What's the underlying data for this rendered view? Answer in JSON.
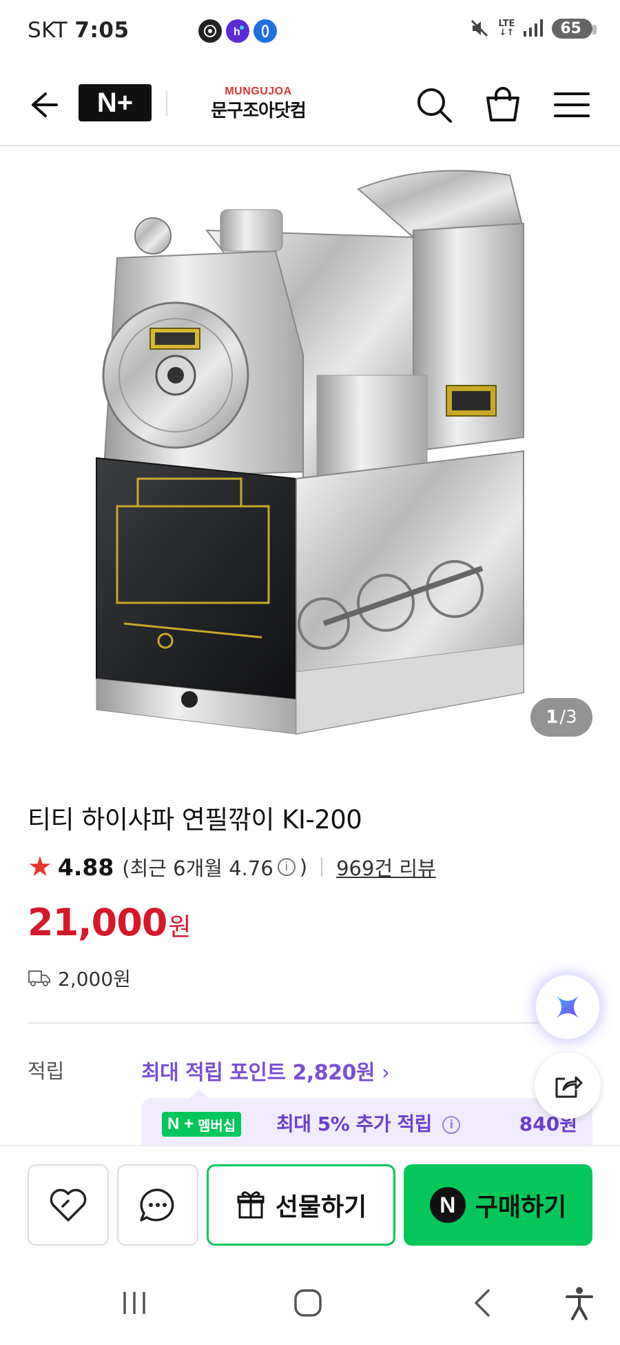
{
  "status_bar": {
    "carrier": "SKT",
    "time": "7:05",
    "network": "LTE",
    "battery": "65"
  },
  "header": {
    "logo_text": "N+",
    "store_logo_en": "MUNGUJOA",
    "store_logo_ko": "문구조아닷컴"
  },
  "gallery": {
    "current": "1",
    "separator": "/",
    "total": "3"
  },
  "product": {
    "title": "티티 하이샤파 연필깎이 KI-200",
    "rating": "4.88",
    "recent_rating_prefix": "(최근 6개월 4.76",
    "recent_rating_suffix": ")",
    "review_count": "969건 리뷰",
    "price": "21,000",
    "currency": "원",
    "shipping_fee": "2,000원"
  },
  "points": {
    "label": "적립",
    "max_points": "최대 적립 포인트 2,820원",
    "membership_badge": "멤버십",
    "membership_text": "최대 5% 추가 적립",
    "membership_amount": "840원"
  },
  "actions": {
    "gift_label": "선물하기",
    "buy_label": "구매하기",
    "buy_icon_letter": "N"
  },
  "colors": {
    "accent_green": "#03c75a",
    "price_red": "#d5182a",
    "points_purple": "#7b4fd2"
  }
}
